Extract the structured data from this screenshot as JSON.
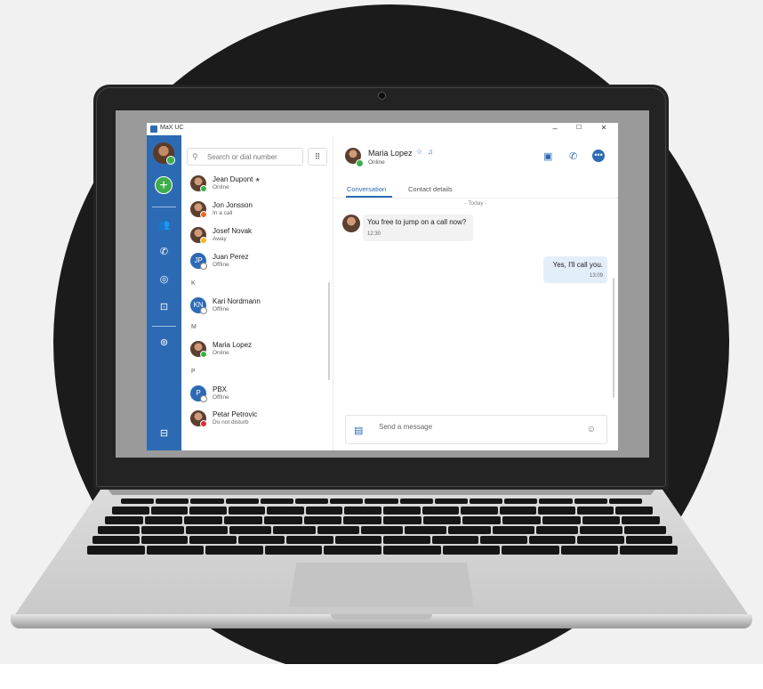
{
  "app": {
    "title": "MaX UC"
  },
  "window_controls": {
    "minimize": "–",
    "maximize": "☐",
    "close": "✕"
  },
  "rail": {
    "add": "+",
    "icons": [
      "contacts-icon",
      "calls-icon",
      "chat-icon",
      "meetings-icon",
      "voicemail-icon",
      "phone-device-icon"
    ],
    "glyphs": {
      "contacts": "👥",
      "calls": "✆",
      "chat": "◎",
      "meetings": "⊡",
      "voicemail": "⊚",
      "device": "⊟"
    }
  },
  "search": {
    "placeholder": "Search or dial number",
    "icon": "⚲",
    "dialpad": "⠿"
  },
  "contacts": [
    {
      "name": "Jean Dupont",
      "status": "Online",
      "starred": true,
      "avatar": "photo",
      "status_color": "#3fae4a"
    },
    {
      "name": "Jon Jonsson",
      "status": "In a call",
      "avatar": "photo",
      "status_color": "#e6692a"
    },
    {
      "name": "Josef Novak",
      "status": "Away",
      "avatar": "photo",
      "status_color": "#f2b62c"
    },
    {
      "name": "Juan Perez",
      "status": "Offline",
      "avatar": "JP",
      "status_color": "#ffffff"
    },
    {
      "name": "Kari Nordmann",
      "status": "Offline",
      "avatar": "KN",
      "status_color": "#ffffff"
    },
    {
      "name": "Maria Lopez",
      "status": "Online",
      "avatar": "photo",
      "status_color": "#3fae4a"
    },
    {
      "name": "PBX",
      "status": "Offline",
      "avatar": "P",
      "status_color": "#ffffff"
    },
    {
      "name": "Petar Petrovic",
      "status": "Do not disturb",
      "avatar": "photo",
      "status_color": "#d3343a"
    }
  ],
  "letters": [
    "K",
    "M",
    "P"
  ],
  "star_glyph": "★",
  "chat": {
    "name": "Maria Lopez",
    "status": "Online",
    "star": "☆",
    "bell": "♫",
    "tabs": [
      "Conversation",
      "Contact details"
    ],
    "date_divider": "- Today -",
    "messages": [
      {
        "direction": "in",
        "text": "You free to jump on a call now?",
        "time": "12:30"
      },
      {
        "direction": "out",
        "text": "Yes, I'll call you.",
        "time": "13:09"
      }
    ],
    "composer_placeholder": "Send a message",
    "actions": {
      "video": "▣",
      "call": "✆",
      "more": "•••"
    },
    "composer_icon": "▤",
    "emoji": "☺"
  },
  "colors": {
    "brand": "#2d6ab4",
    "online": "#3fae4a",
    "bubble_out": "#e3eefb",
    "bubble_in": "#f2f2f2"
  }
}
